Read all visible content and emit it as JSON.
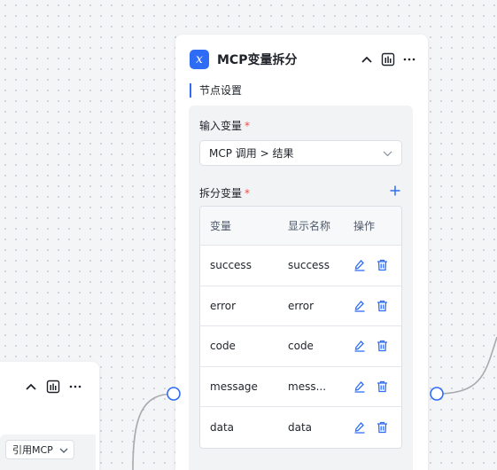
{
  "left_node": {
    "reference_select": {
      "value": "引用MCP"
    }
  },
  "node": {
    "title": "MCP变量拆分",
    "section_title": "节点设置",
    "input_label": "输入变量",
    "required_mark": "*",
    "input_value": "MCP 调用 > 结果",
    "split_label": "拆分变量",
    "table": {
      "headers": [
        "变量",
        "显示名称",
        "操作"
      ],
      "rows": [
        {
          "variable": "success",
          "display": "success"
        },
        {
          "variable": "error",
          "display": "error"
        },
        {
          "variable": "code",
          "display": "code"
        },
        {
          "variable": "message",
          "display": "mess..."
        },
        {
          "variable": "data",
          "display": "data"
        }
      ]
    }
  },
  "colors": {
    "accent": "#2f6cf6",
    "required": "#f54a45",
    "wire": "#a8aaad"
  }
}
